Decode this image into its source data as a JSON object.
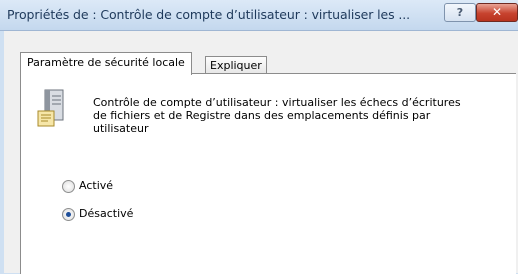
{
  "window": {
    "title": "Propriétés de : Contrôle de compte d’utilisateur : virtualiser les ...",
    "help_label": "?",
    "close_label": "✕"
  },
  "tabs": [
    {
      "label": "Paramètre de sécurité locale",
      "active": true
    },
    {
      "label": "Expliquer",
      "active": false
    }
  ],
  "policy": {
    "icon": "policy-document-icon",
    "description_lines": [
      "Contrôle de compte d’utilisateur : virtualiser les échecs d’écritures",
      "de fichiers et de Registre dans des emplacements définis par",
      "utilisateur"
    ]
  },
  "options": [
    {
      "label": "Activé",
      "checked": false
    },
    {
      "label": "Désactivé",
      "checked": true
    }
  ],
  "colors": {
    "title_bar": "#cfe0f2",
    "close_button": "#c7432f",
    "radio_selected": "#1f4f9a"
  }
}
